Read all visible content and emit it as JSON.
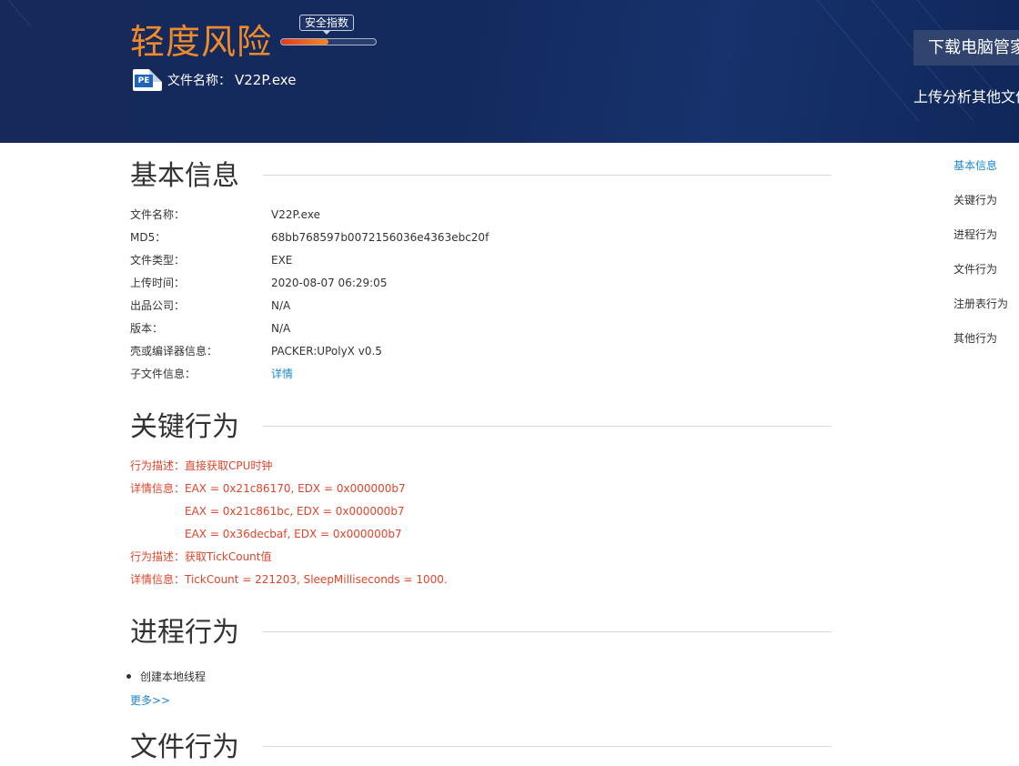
{
  "header": {
    "risk_level": "轻度风险",
    "safety_badge": "安全指数",
    "safety_level": 0.5,
    "pe_icon_label": "PE",
    "file_name_label": "文件名称：",
    "file_name_value": "V22P.exe",
    "download_button": "下载电脑管家",
    "upload_link": "上传分析其他文件",
    "colors": {
      "banner": "#16295a",
      "risk_text": "#f08a2a",
      "bar_fill_start": "#e23a1f",
      "bar_fill_end": "#f58a21"
    }
  },
  "basic_info": {
    "title": "基本信息",
    "rows": [
      {
        "label": "文件名称：",
        "value": "V22P.exe"
      },
      {
        "label": "MD5：",
        "value": "68bb768597b0072156036e4363ebc20f"
      },
      {
        "label": "文件类型：",
        "value": "EXE"
      },
      {
        "label": "上传时间：",
        "value": "2020-08-07 06:29:05"
      },
      {
        "label": "出品公司：",
        "value": "N/A"
      },
      {
        "label": "版本：",
        "value": "N/A"
      },
      {
        "label": "壳或编译器信息：",
        "value": "PACKER:UPolyX v0.5"
      },
      {
        "label": "子文件信息：",
        "value": "详情"
      }
    ]
  },
  "key_behavior": {
    "title": "关键行为",
    "lines": [
      "行为描述：直接获取CPU时钟",
      "详情信息：EAX = 0x21c86170, EDX = 0x000000b7",
      "EAX = 0x21c861bc, EDX = 0x000000b7",
      "EAX = 0x36decbaf, EDX = 0x000000b7",
      "行为描述：获取TickCount值",
      "详情信息：TickCount = 221203, SleepMilliseconds = 1000."
    ],
    "color": "#e0442b"
  },
  "process_behavior": {
    "title": "进程行为",
    "items": [
      "创建本地线程"
    ],
    "more": "更多>>"
  },
  "file_behavior": {
    "title": "文件行为"
  },
  "side_nav": {
    "items": [
      "基本信息",
      "关键行为",
      "进程行为",
      "文件行为",
      "注册表行为",
      "其他行为"
    ],
    "active_color": "#1e88d0"
  }
}
